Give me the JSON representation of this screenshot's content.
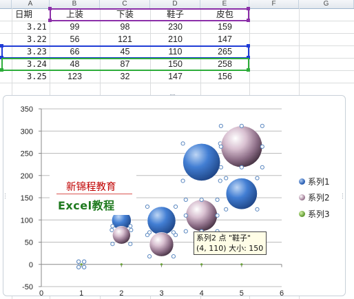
{
  "columns": [
    "A",
    "B",
    "C",
    "D",
    "E",
    "F",
    "G"
  ],
  "table": {
    "headers": [
      "日期",
      "上装",
      "下装",
      "鞋子",
      "皮包"
    ],
    "rows": [
      [
        "3.21",
        "99",
        "98",
        "230",
        "159"
      ],
      [
        "3.22",
        "56",
        "121",
        "210",
        "147"
      ],
      [
        "3.23",
        "66",
        "45",
        "110",
        "265"
      ],
      [
        "3.24",
        "48",
        "87",
        "150",
        "258"
      ],
      [
        "3.25",
        "123",
        "32",
        "147",
        "156"
      ]
    ]
  },
  "watermark": {
    "line1": "新锦程教育",
    "line2": "Excel教程"
  },
  "tooltip": {
    "line1": "系列2 点 \"鞋子\"",
    "line2": "(4, 110) 大小: 150"
  },
  "colors": {
    "series1": "#2e63b8",
    "series2": "#8d6b86",
    "series3": "#6aa33a",
    "range_purple": "#8b2fa8",
    "range_blue": "#1f3bd6",
    "range_green": "#2dad3a"
  },
  "chart_data": {
    "type": "bubble",
    "xlim": [
      0,
      6
    ],
    "ylim": [
      -50,
      350
    ],
    "xticks": [
      "0",
      "1",
      "2",
      "3",
      "4",
      "5",
      "6"
    ],
    "yticks": [
      "-50",
      "0",
      "50",
      "100",
      "150",
      "200",
      "250",
      "300",
      "350"
    ],
    "grid": true,
    "legend_position": "right",
    "series": [
      {
        "name": "系列1",
        "color": "#2e63b8",
        "points": [
          {
            "x": 1,
            "y": 0,
            "size": 0
          },
          {
            "x": 2,
            "y": 99,
            "size": 56
          },
          {
            "x": 3,
            "y": 98,
            "size": 121
          },
          {
            "x": 4,
            "y": 230,
            "size": 210
          },
          {
            "x": 5,
            "y": 159,
            "size": 147
          }
        ]
      },
      {
        "name": "系列2",
        "color": "#8d6b86",
        "points": [
          {
            "x": 1,
            "y": 0,
            "size": 0
          },
          {
            "x": 2,
            "y": 66,
            "size": 48
          },
          {
            "x": 3,
            "y": 45,
            "size": 87
          },
          {
            "x": 4,
            "y": 110,
            "size": 150
          },
          {
            "x": 5,
            "y": 265,
            "size": 258
          }
        ]
      },
      {
        "name": "系列3",
        "color": "#6aa33a",
        "points": [
          {
            "x": 1,
            "y": 0,
            "size": 0
          },
          {
            "x": 2,
            "y": 0,
            "size": 0
          },
          {
            "x": 3,
            "y": 0,
            "size": 0
          },
          {
            "x": 4,
            "y": 0,
            "size": 0
          },
          {
            "x": 5,
            "y": 0,
            "size": 0
          }
        ]
      }
    ]
  }
}
